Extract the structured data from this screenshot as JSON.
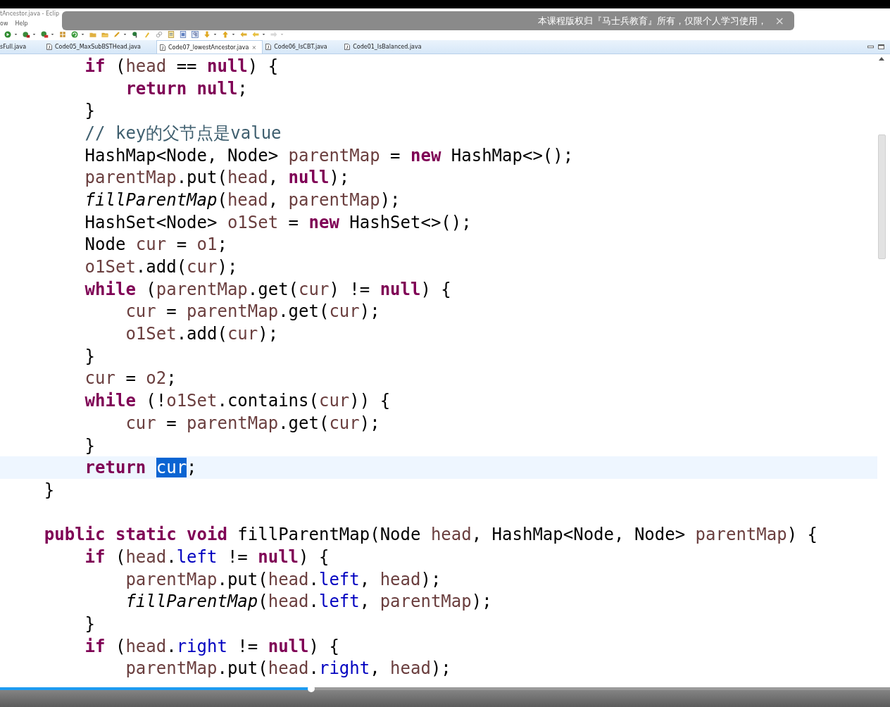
{
  "window": {
    "title": "tAncestor.java - Eclip"
  },
  "menu": [
    "ow",
    "Help"
  ],
  "notice": {
    "text": "本课程版权归『马士兵教育』所有，仅限个人学习使用，",
    "close": "×"
  },
  "tabs": [
    {
      "label": "sFull.java",
      "selected": false
    },
    {
      "label": "Code05_MaxSubBSTHead.java",
      "selected": false
    },
    {
      "label": "Code07_lowestAncestor.java",
      "selected": true,
      "close": "⨯"
    },
    {
      "label": "Code06_IsCBT.java",
      "selected": false
    },
    {
      "label": "Code01_IsBalanced.java",
      "selected": false
    }
  ],
  "editor": {
    "lines": [
      {
        "children": [
          {
            "tokens": [
              {
                "kind": "k",
                "text": "if"
              },
              {
                "kind": "p",
                "text": " ("
              },
              {
                "kind": "v",
                "text": "head"
              },
              {
                "kind": "p",
                "text": " == "
              },
              {
                "kind": "k",
                "text": "null"
              },
              {
                "kind": "p",
                "text": ") {"
              }
            ],
            "children": [
              {
                "tokens": [
                  {
                    "kind": "k",
                    "text": "return "
                  },
                  {
                    "kind": "k",
                    "text": "null"
                  },
                  {
                    "kind": "p",
                    "text": ";"
                  }
                ]
              }
            ]
          },
          {
            "tokens": [
              {
                "kind": "p",
                "text": "}"
              }
            ]
          },
          {
            "tokens": [
              {
                "kind": "c",
                "text": "// key的父节点是value"
              }
            ]
          },
          {
            "tokens": [
              {
                "kind": "p",
                "text": "HashMap<Node, Node> "
              },
              {
                "kind": "v",
                "text": "parentMap"
              },
              {
                "kind": "p",
                "text": " = "
              },
              {
                "kind": "k",
                "text": "new"
              },
              {
                "kind": "p",
                "text": " HashMap<>();"
              }
            ]
          },
          {
            "tokens": [
              {
                "kind": "v",
                "text": "parentMap"
              },
              {
                "kind": "p",
                "text": ".put("
              },
              {
                "kind": "v",
                "text": "head"
              },
              {
                "kind": "p",
                "text": ", "
              },
              {
                "kind": "k",
                "text": "null"
              },
              {
                "kind": "p",
                "text": ");"
              }
            ]
          },
          {
            "tokens": [
              {
                "kind": "m",
                "text": "fillParentMap"
              },
              {
                "kind": "p",
                "text": "("
              },
              {
                "kind": "v",
                "text": "head"
              },
              {
                "kind": "p",
                "text": ", "
              },
              {
                "kind": "v",
                "text": "parentMap"
              },
              {
                "kind": "p",
                "text": ");"
              }
            ]
          },
          {
            "tokens": [
              {
                "kind": "p",
                "text": "HashSet<Node> "
              },
              {
                "kind": "v",
                "text": "o1Set"
              },
              {
                "kind": "p",
                "text": " = "
              },
              {
                "kind": "k",
                "text": "new"
              },
              {
                "kind": "p",
                "text": " HashSet<>();"
              }
            ]
          },
          {
            "tokens": [
              {
                "kind": "p",
                "text": "Node "
              },
              {
                "kind": "v",
                "text": "cur"
              },
              {
                "kind": "p",
                "text": " = "
              },
              {
                "kind": "v",
                "text": "o1"
              },
              {
                "kind": "p",
                "text": ";"
              }
            ]
          },
          {
            "tokens": [
              {
                "kind": "v",
                "text": "o1Set"
              },
              {
                "kind": "p",
                "text": ".add("
              },
              {
                "kind": "v",
                "text": "cur"
              },
              {
                "kind": "p",
                "text": ");"
              }
            ]
          },
          {
            "tokens": [
              {
                "kind": "k",
                "text": "while"
              },
              {
                "kind": "p",
                "text": " ("
              },
              {
                "kind": "v",
                "text": "parentMap"
              },
              {
                "kind": "p",
                "text": ".get("
              },
              {
                "kind": "v",
                "text": "cur"
              },
              {
                "kind": "p",
                "text": ") != "
              },
              {
                "kind": "k",
                "text": "null"
              },
              {
                "kind": "p",
                "text": ") {"
              }
            ],
            "children": [
              {
                "tokens": [
                  {
                    "kind": "v",
                    "text": "cur"
                  },
                  {
                    "kind": "p",
                    "text": " = "
                  },
                  {
                    "kind": "v",
                    "text": "parentMap"
                  },
                  {
                    "kind": "p",
                    "text": ".get("
                  },
                  {
                    "kind": "v",
                    "text": "cur"
                  },
                  {
                    "kind": "p",
                    "text": ");"
                  }
                ]
              },
              {
                "tokens": [
                  {
                    "kind": "v",
                    "text": "o1Set"
                  },
                  {
                    "kind": "p",
                    "text": ".add("
                  },
                  {
                    "kind": "v",
                    "text": "cur"
                  },
                  {
                    "kind": "p",
                    "text": ");"
                  }
                ]
              }
            ]
          },
          {
            "tokens": [
              {
                "kind": "p",
                "text": "}"
              }
            ]
          },
          {
            "tokens": [
              {
                "kind": "v",
                "text": "cur"
              },
              {
                "kind": "p",
                "text": " = "
              },
              {
                "kind": "v",
                "text": "o2"
              },
              {
                "kind": "p",
                "text": ";"
              }
            ]
          },
          {
            "tokens": [
              {
                "kind": "k",
                "text": "while"
              },
              {
                "kind": "p",
                "text": " (!"
              },
              {
                "kind": "v",
                "text": "o1Set"
              },
              {
                "kind": "p",
                "text": ".contains("
              },
              {
                "kind": "v",
                "text": "cur"
              },
              {
                "kind": "p",
                "text": ")) {"
              }
            ],
            "children": [
              {
                "tokens": [
                  {
                    "kind": "v",
                    "text": "cur"
                  },
                  {
                    "kind": "p",
                    "text": " = "
                  },
                  {
                    "kind": "v",
                    "text": "parentMap"
                  },
                  {
                    "kind": "p",
                    "text": ".get("
                  },
                  {
                    "kind": "v",
                    "text": "cur"
                  },
                  {
                    "kind": "p",
                    "text": ");"
                  }
                ]
              }
            ]
          },
          {
            "tokens": [
              {
                "kind": "p",
                "text": "}"
              }
            ]
          },
          {
            "current": true,
            "tokens": [
              {
                "kind": "k",
                "text": "return "
              },
              {
                "kind": "s",
                "text": "cur"
              },
              {
                "kind": "p",
                "text": ";"
              }
            ]
          }
        ]
      },
      {
        "tokens": [
          {
            "kind": "p",
            "text": "}"
          }
        ]
      },
      {
        "kind": "blank"
      },
      {
        "tokens": [
          {
            "kind": "k",
            "text": "public "
          },
          {
            "kind": "k",
            "text": "static "
          },
          {
            "kind": "k",
            "text": "void"
          },
          {
            "kind": "p",
            "text": " fillParentMap(Node "
          },
          {
            "kind": "v",
            "text": "head"
          },
          {
            "kind": "p",
            "text": ", HashMap<Node, Node> "
          },
          {
            "kind": "v",
            "text": "parentMap"
          },
          {
            "kind": "p",
            "text": ") {"
          }
        ],
        "children": [
          {
            "tokens": [
              {
                "kind": "k",
                "text": "if"
              },
              {
                "kind": "p",
                "text": " ("
              },
              {
                "kind": "v",
                "text": "head"
              },
              {
                "kind": "p",
                "text": "."
              },
              {
                "kind": "f",
                "text": "left"
              },
              {
                "kind": "p",
                "text": " != "
              },
              {
                "kind": "k",
                "text": "null"
              },
              {
                "kind": "p",
                "text": ") {"
              }
            ],
            "children": [
              {
                "tokens": [
                  {
                    "kind": "v",
                    "text": "parentMap"
                  },
                  {
                    "kind": "p",
                    "text": ".put("
                  },
                  {
                    "kind": "v",
                    "text": "head"
                  },
                  {
                    "kind": "p",
                    "text": "."
                  },
                  {
                    "kind": "f",
                    "text": "left"
                  },
                  {
                    "kind": "p",
                    "text": ", "
                  },
                  {
                    "kind": "v",
                    "text": "head"
                  },
                  {
                    "kind": "p",
                    "text": ");"
                  }
                ]
              },
              {
                "tokens": [
                  {
                    "kind": "m",
                    "text": "fillParentMap"
                  },
                  {
                    "kind": "p",
                    "text": "("
                  },
                  {
                    "kind": "v",
                    "text": "head"
                  },
                  {
                    "kind": "p",
                    "text": "."
                  },
                  {
                    "kind": "f",
                    "text": "left"
                  },
                  {
                    "kind": "p",
                    "text": ", "
                  },
                  {
                    "kind": "v",
                    "text": "parentMap"
                  },
                  {
                    "kind": "p",
                    "text": ");"
                  }
                ]
              }
            ]
          },
          {
            "tokens": [
              {
                "kind": "p",
                "text": "}"
              }
            ]
          },
          {
            "tokens": [
              {
                "kind": "k",
                "text": "if"
              },
              {
                "kind": "p",
                "text": " ("
              },
              {
                "kind": "v",
                "text": "head"
              },
              {
                "kind": "p",
                "text": "."
              },
              {
                "kind": "f",
                "text": "right"
              },
              {
                "kind": "p",
                "text": " != "
              },
              {
                "kind": "k",
                "text": "null"
              },
              {
                "kind": "p",
                "text": ") {"
              }
            ],
            "children": [
              {
                "tokens": [
                  {
                    "kind": "v",
                    "text": "parentMap"
                  },
                  {
                    "kind": "p",
                    "text": ".put("
                  },
                  {
                    "kind": "v",
                    "text": "head"
                  },
                  {
                    "kind": "p",
                    "text": "."
                  },
                  {
                    "kind": "f",
                    "text": "right"
                  },
                  {
                    "kind": "p",
                    "text": ", "
                  },
                  {
                    "kind": "v",
                    "text": "head"
                  },
                  {
                    "kind": "p",
                    "text": ");"
                  }
                ]
              }
            ]
          }
        ]
      }
    ]
  },
  "player": {
    "progress": {
      "level": 0.35
    }
  }
}
